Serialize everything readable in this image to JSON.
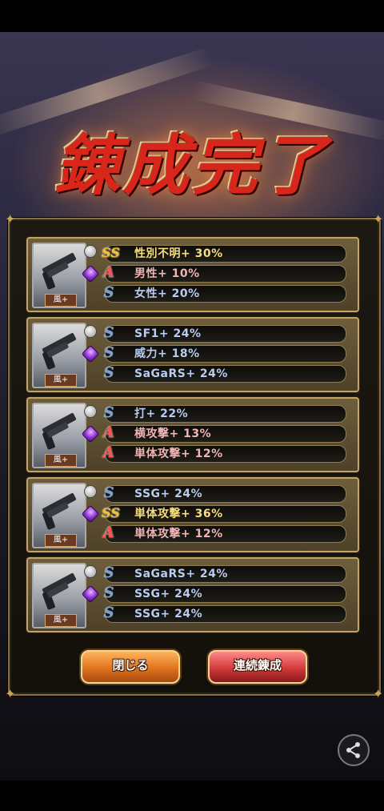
{
  "title": "錬成完了",
  "cards": [
    {
      "weapon_tag": "風+",
      "effects": [
        {
          "rank": "SS",
          "text": "性別不明+ 30%"
        },
        {
          "rank": "A",
          "text": "男性+ 10%"
        },
        {
          "rank": "S",
          "text": "女性+ 20%"
        }
      ]
    },
    {
      "weapon_tag": "風+",
      "effects": [
        {
          "rank": "S",
          "text": "SF1+ 24%"
        },
        {
          "rank": "S",
          "text": "威力+ 18%"
        },
        {
          "rank": "S",
          "text": "SaGaRS+ 24%"
        }
      ]
    },
    {
      "weapon_tag": "風+",
      "effects": [
        {
          "rank": "S",
          "text": "打+ 22%"
        },
        {
          "rank": "A",
          "text": "横攻撃+ 13%"
        },
        {
          "rank": "A",
          "text": "単体攻撃+ 12%"
        }
      ]
    },
    {
      "weapon_tag": "風+",
      "effects": [
        {
          "rank": "S",
          "text": "SSG+ 24%"
        },
        {
          "rank": "SS",
          "text": "単体攻撃+ 36%"
        },
        {
          "rank": "A",
          "text": "単体攻撃+ 12%"
        }
      ]
    },
    {
      "weapon_tag": "風+",
      "effects": [
        {
          "rank": "S",
          "text": "SaGaRS+ 24%"
        },
        {
          "rank": "S",
          "text": "SSG+ 24%"
        },
        {
          "rank": "S",
          "text": "SSG+ 24%"
        }
      ]
    }
  ],
  "buttons": {
    "close_label": "閉じる",
    "again_label": "連続錬成"
  },
  "icons": {
    "share": "share-icon",
    "weapon": "pistol-icon",
    "gem": "purple-gem-icon"
  },
  "colors": {
    "title": "#d8261a",
    "rank_S": "#7ea0d0",
    "rank_SS": "#f0c030",
    "rank_A": "#ff5050"
  }
}
